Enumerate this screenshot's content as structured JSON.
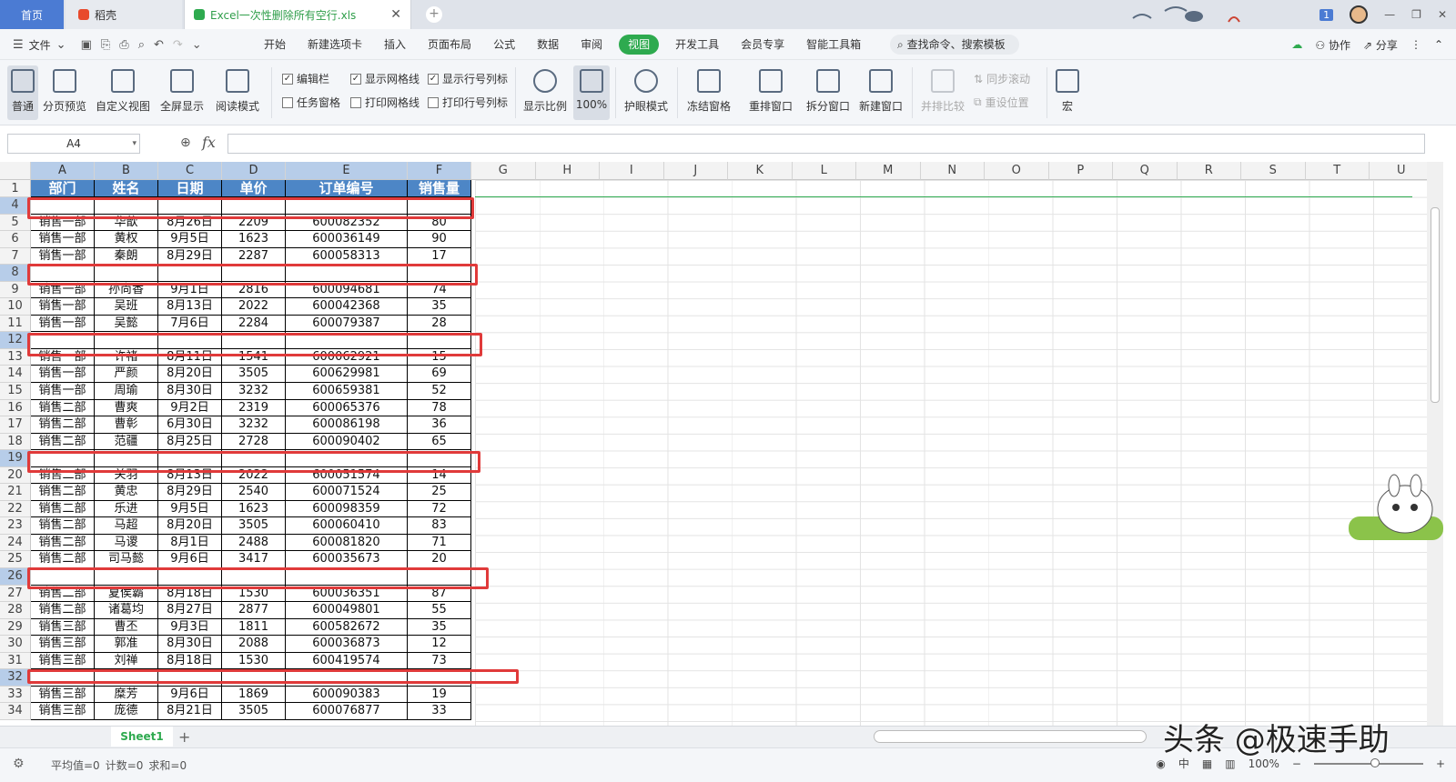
{
  "tabs": {
    "home": "首页",
    "daoke": "稻壳",
    "file": "Excel一次性删除所有空行.xls"
  },
  "window": {
    "badge": "1"
  },
  "menu": {
    "file": "文件",
    "items": [
      "开始",
      "新建选项卡",
      "插入",
      "页面布局",
      "公式",
      "数据",
      "审阅",
      "视图",
      "开发工具",
      "会员专享",
      "智能工具箱"
    ],
    "active_index": 7,
    "search": "查找命令、搜索模板",
    "cooperate": "协作",
    "share": "分享"
  },
  "ribbon": {
    "normal": "普通",
    "page_preview": "分页预览",
    "custom_view": "自定义视图",
    "fullscreen": "全屏显示",
    "read_mode": "阅读模式",
    "edit_bar": "编辑栏",
    "task_pane": "任务窗格",
    "show_grid": "显示网格线",
    "print_grid": "打印网格线",
    "show_rowcol": "显示行号列标",
    "print_rowcol": "打印行号列标",
    "zoom_ratio": "显示比例",
    "zoom_100": "100%",
    "eye_mode": "护眼模式",
    "freeze": "冻结窗格",
    "arrange": "重排窗口",
    "split": "拆分窗口",
    "new_window": "新建窗口",
    "side_compare": "并排比较",
    "sync_scroll": "同步滚动",
    "reset_pos": "重设位置",
    "macro": "宏"
  },
  "formula_bar": {
    "name_box": "A4",
    "fx": "fx",
    "content": ""
  },
  "columns": [
    "A",
    "B",
    "C",
    "D",
    "E",
    "F",
    "G",
    "H",
    "I",
    "J",
    "K",
    "L",
    "M",
    "N",
    "O",
    "P",
    "Q",
    "R",
    "S",
    "T",
    "U"
  ],
  "header_row": {
    "num": "1",
    "cells": [
      "部门",
      "姓名",
      "日期",
      "单价",
      "订单编号",
      "销售量"
    ]
  },
  "rows": [
    {
      "num": "4",
      "cells": [
        "",
        "",
        "",
        "",
        "",
        ""
      ],
      "blank": true
    },
    {
      "num": "5",
      "cells": [
        "销售一部",
        "华歆",
        "8月26日",
        "2209",
        "600082352",
        "80"
      ]
    },
    {
      "num": "6",
      "cells": [
        "销售一部",
        "黄权",
        "9月5日",
        "1623",
        "600036149",
        "90"
      ]
    },
    {
      "num": "7",
      "cells": [
        "销售一部",
        "秦朗",
        "8月29日",
        "2287",
        "600058313",
        "17"
      ]
    },
    {
      "num": "8",
      "cells": [
        "",
        "",
        "",
        "",
        "",
        ""
      ],
      "blank": true
    },
    {
      "num": "9",
      "cells": [
        "销售一部",
        "孙尚香",
        "9月1日",
        "2816",
        "600094681",
        "74"
      ]
    },
    {
      "num": "10",
      "cells": [
        "销售一部",
        "吴班",
        "8月13日",
        "2022",
        "600042368",
        "35"
      ]
    },
    {
      "num": "11",
      "cells": [
        "销售一部",
        "吴懿",
        "7月6日",
        "2284",
        "600079387",
        "28"
      ]
    },
    {
      "num": "12",
      "cells": [
        "",
        "",
        "",
        "",
        "",
        ""
      ],
      "blank": true
    },
    {
      "num": "13",
      "cells": [
        "销售一部",
        "许褚",
        "8月11日",
        "1541",
        "600062921",
        "15"
      ]
    },
    {
      "num": "14",
      "cells": [
        "销售一部",
        "严颜",
        "8月20日",
        "3505",
        "600629981",
        "69"
      ]
    },
    {
      "num": "15",
      "cells": [
        "销售一部",
        "周瑜",
        "8月30日",
        "3232",
        "600659381",
        "52"
      ]
    },
    {
      "num": "16",
      "cells": [
        "销售二部",
        "曹爽",
        "9月2日",
        "2319",
        "600065376",
        "78"
      ]
    },
    {
      "num": "17",
      "cells": [
        "销售二部",
        "曹彰",
        "6月30日",
        "3232",
        "600086198",
        "36"
      ]
    },
    {
      "num": "18",
      "cells": [
        "销售二部",
        "范疆",
        "8月25日",
        "2728",
        "600090402",
        "65"
      ]
    },
    {
      "num": "19",
      "cells": [
        "",
        "",
        "",
        "",
        "",
        ""
      ],
      "blank": true
    },
    {
      "num": "20",
      "cells": [
        "销售二部",
        "关羽",
        "8月13日",
        "2022",
        "600051574",
        "14"
      ]
    },
    {
      "num": "21",
      "cells": [
        "销售二部",
        "黄忠",
        "8月29日",
        "2540",
        "600071524",
        "25"
      ]
    },
    {
      "num": "22",
      "cells": [
        "销售二部",
        "乐进",
        "9月5日",
        "1623",
        "600098359",
        "72"
      ]
    },
    {
      "num": "23",
      "cells": [
        "销售二部",
        "马超",
        "8月20日",
        "3505",
        "600060410",
        "83"
      ]
    },
    {
      "num": "24",
      "cells": [
        "销售二部",
        "马谡",
        "8月1日",
        "2488",
        "600081820",
        "71"
      ]
    },
    {
      "num": "25",
      "cells": [
        "销售二部",
        "司马懿",
        "9月6日",
        "3417",
        "600035673",
        "20"
      ]
    },
    {
      "num": "26",
      "cells": [
        "",
        "",
        "",
        "",
        "",
        ""
      ],
      "blank": true
    },
    {
      "num": "27",
      "cells": [
        "销售二部",
        "夏侯霸",
        "8月18日",
        "1530",
        "600036351",
        "87"
      ]
    },
    {
      "num": "28",
      "cells": [
        "销售二部",
        "诸葛均",
        "8月27日",
        "2877",
        "600049801",
        "55"
      ]
    },
    {
      "num": "29",
      "cells": [
        "销售三部",
        "曹丕",
        "9月3日",
        "1811",
        "600582672",
        "35"
      ]
    },
    {
      "num": "30",
      "cells": [
        "销售三部",
        "郭准",
        "8月30日",
        "2088",
        "600036873",
        "12"
      ]
    },
    {
      "num": "31",
      "cells": [
        "销售三部",
        "刘禅",
        "8月18日",
        "1530",
        "600419574",
        "73"
      ]
    },
    {
      "num": "32",
      "cells": [
        "",
        "",
        "",
        "",
        "",
        ""
      ],
      "blank": true
    },
    {
      "num": "33",
      "cells": [
        "销售三部",
        "糜芳",
        "9月6日",
        "1869",
        "600090383",
        "19"
      ]
    },
    {
      "num": "34",
      "cells": [
        "销售三部",
        "庞德",
        "8月21日",
        "3505",
        "600076877",
        "33"
      ]
    }
  ],
  "sheet": {
    "name": "Sheet1"
  },
  "status": {
    "avg": "平均值=0",
    "count": "计数=0",
    "sum": "求和=0",
    "zoom": "100%"
  },
  "watermark": "头条 @极速手助",
  "colors": {
    "accent": "#2eaa4f",
    "header_fill": "#4d86c6",
    "highlight": "#e03a3a",
    "tab_blue": "#4b7bd3"
  }
}
